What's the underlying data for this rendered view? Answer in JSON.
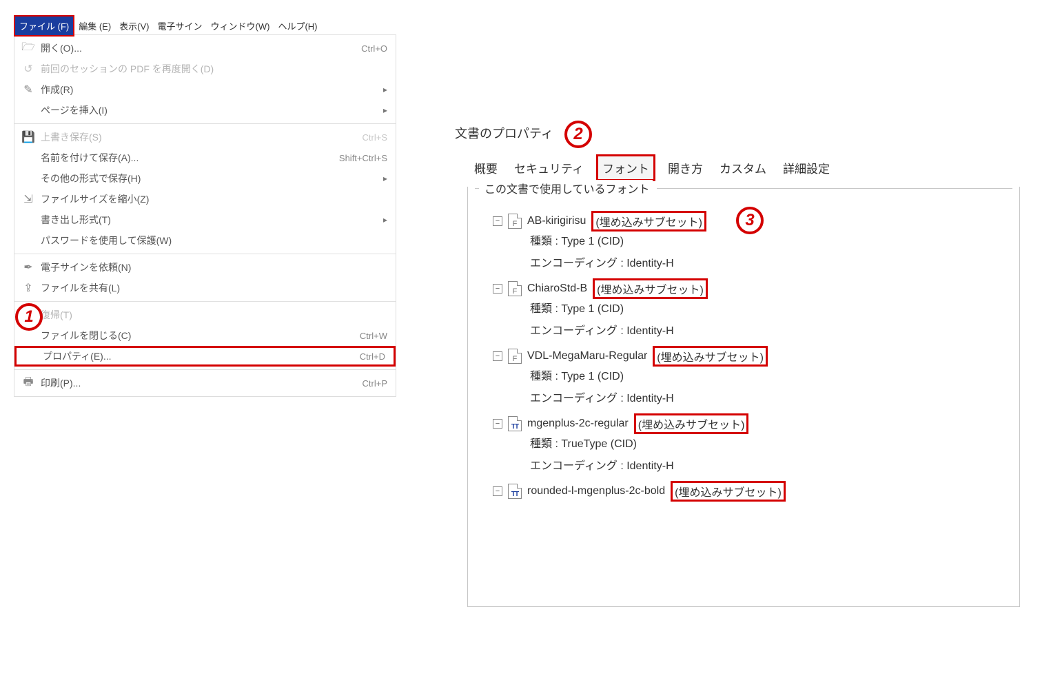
{
  "menubar": {
    "items": [
      {
        "label": "ファイル (F)",
        "selected": true
      },
      {
        "label": "編集 (E)"
      },
      {
        "label": "表示(V)"
      },
      {
        "label": "電子サイン"
      },
      {
        "label": "ウィンドウ(W)"
      },
      {
        "label": "ヘルプ(H)"
      }
    ]
  },
  "dropdown": {
    "groups": [
      [
        {
          "icon": "folder-open",
          "label": "開く(O)...",
          "shortcut": "Ctrl+O",
          "disabled": false
        },
        {
          "icon": "history",
          "label": "前回のセッションの PDF を再度開く(D)",
          "disabled": true
        },
        {
          "icon": "create",
          "label": "作成(R)",
          "submenu": true,
          "disabled": false
        },
        {
          "icon": "",
          "label": "ページを挿入(I)",
          "submenu": true,
          "disabled": false
        }
      ],
      [
        {
          "icon": "save",
          "label": "上書き保存(S)",
          "shortcut": "Ctrl+S",
          "disabled": true
        },
        {
          "icon": "",
          "label": "名前を付けて保存(A)...",
          "shortcut": "Shift+Ctrl+S",
          "disabled": false
        },
        {
          "icon": "",
          "label": "その他の形式で保存(H)",
          "submenu": true,
          "disabled": false
        },
        {
          "icon": "reduce",
          "label": "ファイルサイズを縮小(Z)",
          "disabled": false
        },
        {
          "icon": "",
          "label": "書き出し形式(T)",
          "submenu": true,
          "disabled": false
        },
        {
          "icon": "",
          "label": "パスワードを使用して保護(W)",
          "disabled": false
        }
      ],
      [
        {
          "icon": "signature",
          "label": "電子サインを依頼(N)",
          "disabled": false
        },
        {
          "icon": "share",
          "label": "ファイルを共有(L)",
          "disabled": false
        }
      ],
      [
        {
          "icon": "",
          "label": "復帰(T)",
          "disabled": true
        },
        {
          "icon": "",
          "label": "ファイルを閉じる(C)",
          "shortcut": "Ctrl+W",
          "disabled": false
        },
        {
          "icon": "",
          "label": "プロパティ(E)...",
          "shortcut": "Ctrl+D",
          "highlight": true,
          "disabled": false
        }
      ],
      [
        {
          "icon": "print",
          "label": "印刷(P)...",
          "shortcut": "Ctrl+P",
          "disabled": false
        }
      ]
    ]
  },
  "dialog": {
    "title": "文書のプロパティ",
    "tabs": [
      "概要",
      "セキュリティ",
      "フォント",
      "開き方",
      "カスタム",
      "詳細設定"
    ],
    "active_tab": "フォント",
    "group_title": "この文書で使用しているフォント",
    "type_label": "種類 :",
    "encoding_label": "エンコーディング :",
    "embed_text": "埋め込みサブセット",
    "fonts": [
      {
        "icon": "F",
        "name": "AB-kirigirisu",
        "embed_boxed": true,
        "type": "Type 1 (CID)",
        "encoding": "Identity-H"
      },
      {
        "icon": "F",
        "name": "ChiaroStd-B",
        "embed_boxed": true,
        "type": "Type 1 (CID)",
        "encoding": "Identity-H"
      },
      {
        "icon": "F",
        "name": "VDL-MegaMaru-Regular",
        "embed_boxed": true,
        "type": "Type 1 (CID)",
        "encoding": "Identity-H"
      },
      {
        "icon": "TT",
        "name": "mgenplus-2c-regular",
        "embed_boxed": true,
        "type": "TrueType (CID)",
        "encoding": "Identity-H"
      },
      {
        "icon": "TT",
        "name": "rounded-l-mgenplus-2c-bold",
        "embed_boxed": true,
        "type": "",
        "encoding": ""
      }
    ]
  },
  "annotations": {
    "a1": "1",
    "a2": "2",
    "a3": "3"
  }
}
